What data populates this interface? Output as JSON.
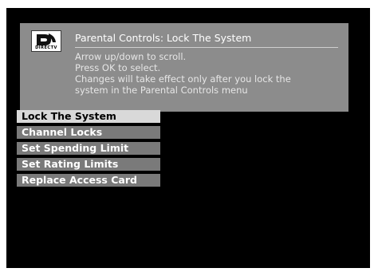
{
  "logo": {
    "text": "DIRECTV",
    "icon": "directv-logo-icon"
  },
  "header": {
    "title": "Parental Controls: Lock The System",
    "help_lines": [
      "Arrow up/down to scroll.",
      "Press OK to select.",
      "Changes will take effect only after you lock the",
      "system in the Parental Controls menu"
    ]
  },
  "menu": {
    "items": [
      {
        "label": "Lock The System",
        "selected": true
      },
      {
        "label": "Channel Locks",
        "selected": false
      },
      {
        "label": "Set Spending Limit",
        "selected": false
      },
      {
        "label": "Set Rating Limits",
        "selected": false
      },
      {
        "label": "Replace Access Card",
        "selected": false
      }
    ]
  },
  "colors": {
    "background": "#000000",
    "header_panel": "#8c8c8c",
    "menu_item": "#7a7a7a",
    "menu_item_selected": "#d9d9d9"
  }
}
